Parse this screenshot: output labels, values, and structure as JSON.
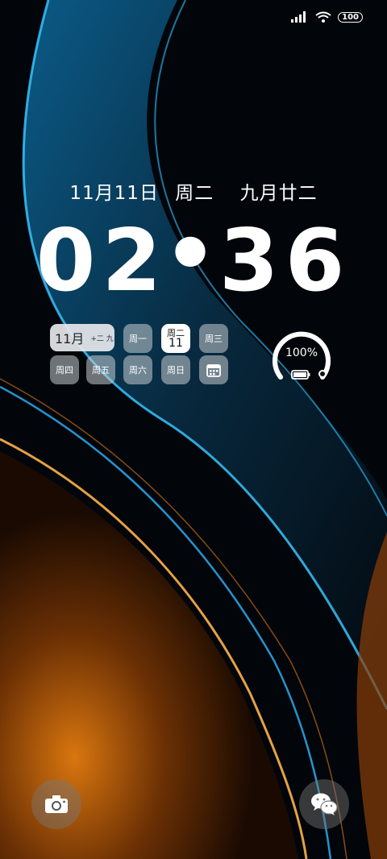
{
  "status_bar": {
    "signal_icon": "cellular-signal-icon",
    "wifi_icon": "wifi-icon",
    "battery_level": "100"
  },
  "lockscreen": {
    "date": "11月11日",
    "weekday": "周二",
    "lunar_date": "九月廿二",
    "clock_hours": "02",
    "clock_minutes": "36"
  },
  "calendar_widget": {
    "month_label": "11月",
    "month_sub_label": "+二 九",
    "days": [
      "周一",
      "周二",
      "周三",
      "周四",
      "周五",
      "周六",
      "周日"
    ],
    "today_weekday": "周二",
    "today_date": "11",
    "calendar_icon": "calendar-icon"
  },
  "battery_widget": {
    "percent_label": "100%",
    "level": 1.0
  },
  "shortcuts": {
    "left": "camera-icon",
    "right": "wechat-icon"
  },
  "colors": {
    "wallpaper_blue": "#1ea7e8",
    "wallpaper_orange": "#e8831c"
  }
}
